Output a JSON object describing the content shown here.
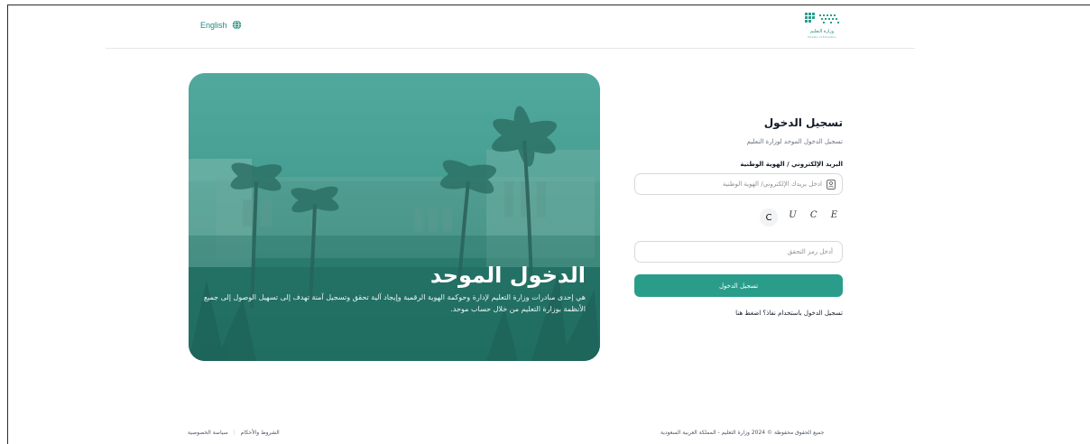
{
  "header": {
    "language_label": "English",
    "logo_title": "وزارة التعليم",
    "logo_subtitle": "Ministry of Education"
  },
  "hero": {
    "title": "الدخول الموحد",
    "description": "هي إحدى مبادرات وزارة التعليم لإدارة وحوكمة الهوية الرقمية وإيجاد آلية تحقق وتسجيل آمنة تهدف إلى تسهيل الوصول إلى جميع الأنظمة بوزارة التعليم من خلال حساب موحد."
  },
  "form": {
    "title": "تسجيل الدخول",
    "subtitle": "تسجيل الدخول الموحد لوزارة التعليم",
    "id_label": "البريد الإلكتروني / الهوية الوطنية",
    "id_placeholder": "ادخل بريدك الإلكتروني/ الهوية الوطنية",
    "captcha_text": "S U C E",
    "refresh_symbol": "C",
    "code_placeholder": "أدخل رمز التحقق",
    "submit_label": "تسجيل الدخول",
    "alt_login": "تسجيل الدخول باستخدام نفاذ؟ اضغط هنا"
  },
  "footer": {
    "copyright": "جميع الحقوق محفوظة © 2024 وزارة التعليم - المملكة العربية السعودية",
    "terms": "الشروط والأحكام",
    "separator": "|",
    "privacy": "سياسة الخصوصية"
  },
  "colors": {
    "accent": "#2a9d8a",
    "link": "#1f8a7e"
  },
  "icons": {
    "language": "globe-icon",
    "id_field": "id-card-icon",
    "captcha_refresh": "refresh-icon"
  }
}
